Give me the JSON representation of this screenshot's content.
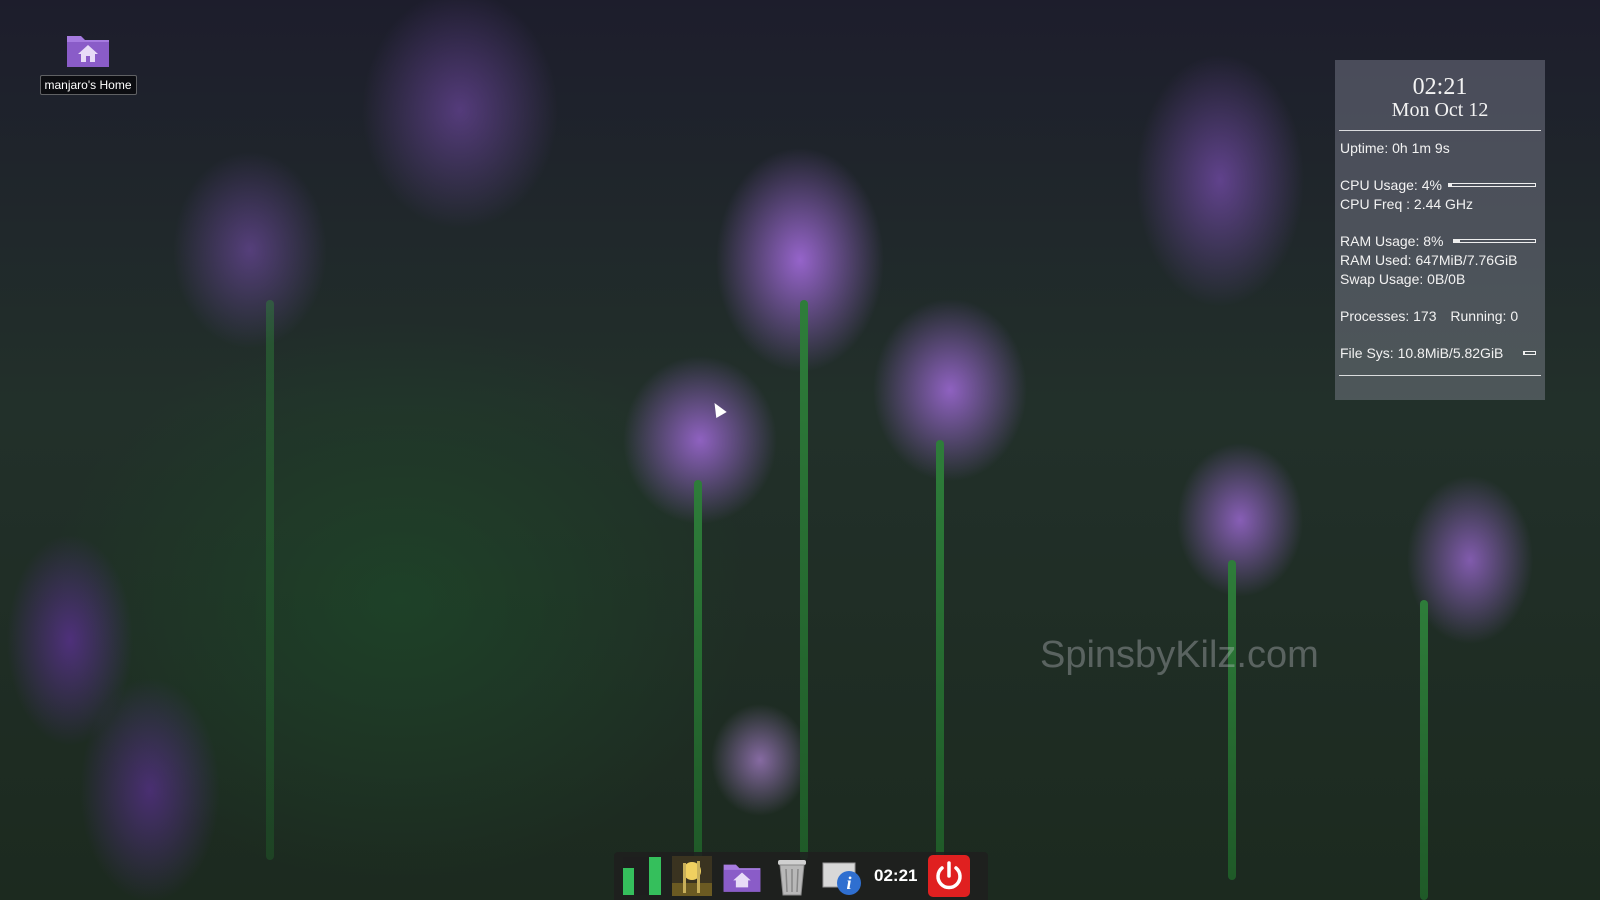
{
  "desktop": {
    "home_icon": {
      "icon": "folder-home-icon",
      "label": "manjaro's Home"
    }
  },
  "conky": {
    "time": "02:21",
    "date": "Mon Oct 12",
    "uptime": "Uptime: 0h 1m 9s",
    "cpu_usage": "CPU Usage: 4%",
    "cpu_usage_fraction": 0.04,
    "cpu_freq": "CPU Freq : 2.44 GHz",
    "ram_usage": "RAM Usage: 8%",
    "ram_usage_fraction": 0.08,
    "ram_used": "RAM Used: 647MiB/7.76GiB",
    "swap_usage": "Swap Usage: 0B/0B",
    "processes": "Processes: 173",
    "running": "Running: 0",
    "file_sys": "File Sys: 10.8MiB/5.82GiB",
    "file_sys_fraction": 0.002
  },
  "watermark": "SpinsbyKilz.com",
  "dock": {
    "items": [
      {
        "icon": "manjaro-logo-icon"
      },
      {
        "icon": "wallpaper-app-icon"
      },
      {
        "icon": "home-folder-icon"
      },
      {
        "icon": "trash-icon"
      },
      {
        "icon": "system-info-icon"
      }
    ],
    "clock": "02:21",
    "power_icon": "power-icon"
  },
  "colors": {
    "power_red": "#e02020",
    "manjaro_green": "#35bf5c",
    "folder_purple": "#8a5cc8"
  }
}
